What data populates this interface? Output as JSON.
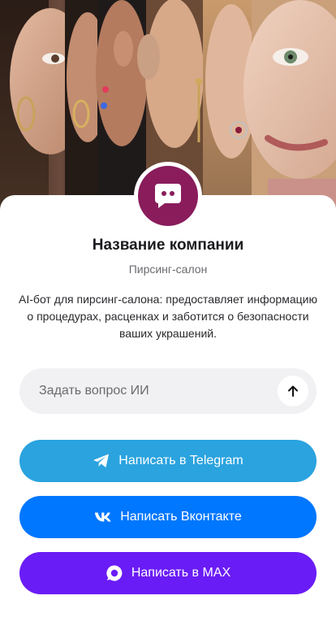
{
  "company": {
    "name": "Название компании",
    "category": "Пирсинг-салон",
    "description": "AI-бот для пирсинг-салона: предоставляет информацию о процедурах, расценках и заботится о безопасности ваших украшений."
  },
  "ask": {
    "placeholder": "Задать вопрос ИИ",
    "send_icon": "arrow-up-icon"
  },
  "buttons": {
    "telegram": {
      "label": "Написать в Telegram",
      "icon": "telegram-icon",
      "color": "#2aa3df"
    },
    "vk": {
      "label": "Написать Вконтакте",
      "icon": "vk-icon",
      "color": "#0077ff"
    },
    "max": {
      "label": "Написать в MAX",
      "icon": "max-icon",
      "color": "#6a1cf6"
    }
  },
  "colors": {
    "avatar": "#8a1c5c"
  }
}
